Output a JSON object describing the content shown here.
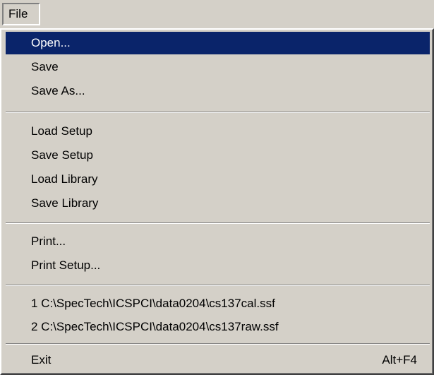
{
  "menubar": {
    "file_label": "File"
  },
  "menu": {
    "open": "Open...",
    "save": "Save",
    "save_as": "Save As...",
    "load_setup": "Load Setup",
    "save_setup": "Save Setup",
    "load_library": "Load Library",
    "save_library": "Save Library",
    "print": "Print...",
    "print_setup": "Print Setup...",
    "recent_1": "1 C:\\SpecTech\\ICSPCI\\data0204\\cs137cal.ssf",
    "recent_2": "2 C:\\SpecTech\\ICSPCI\\data0204\\cs137raw.ssf",
    "exit": "Exit",
    "exit_shortcut": "Alt+F4"
  },
  "colors": {
    "menu_background": "#d4d0c8",
    "highlight": "#0a246a",
    "highlight_text": "#ffffff"
  }
}
